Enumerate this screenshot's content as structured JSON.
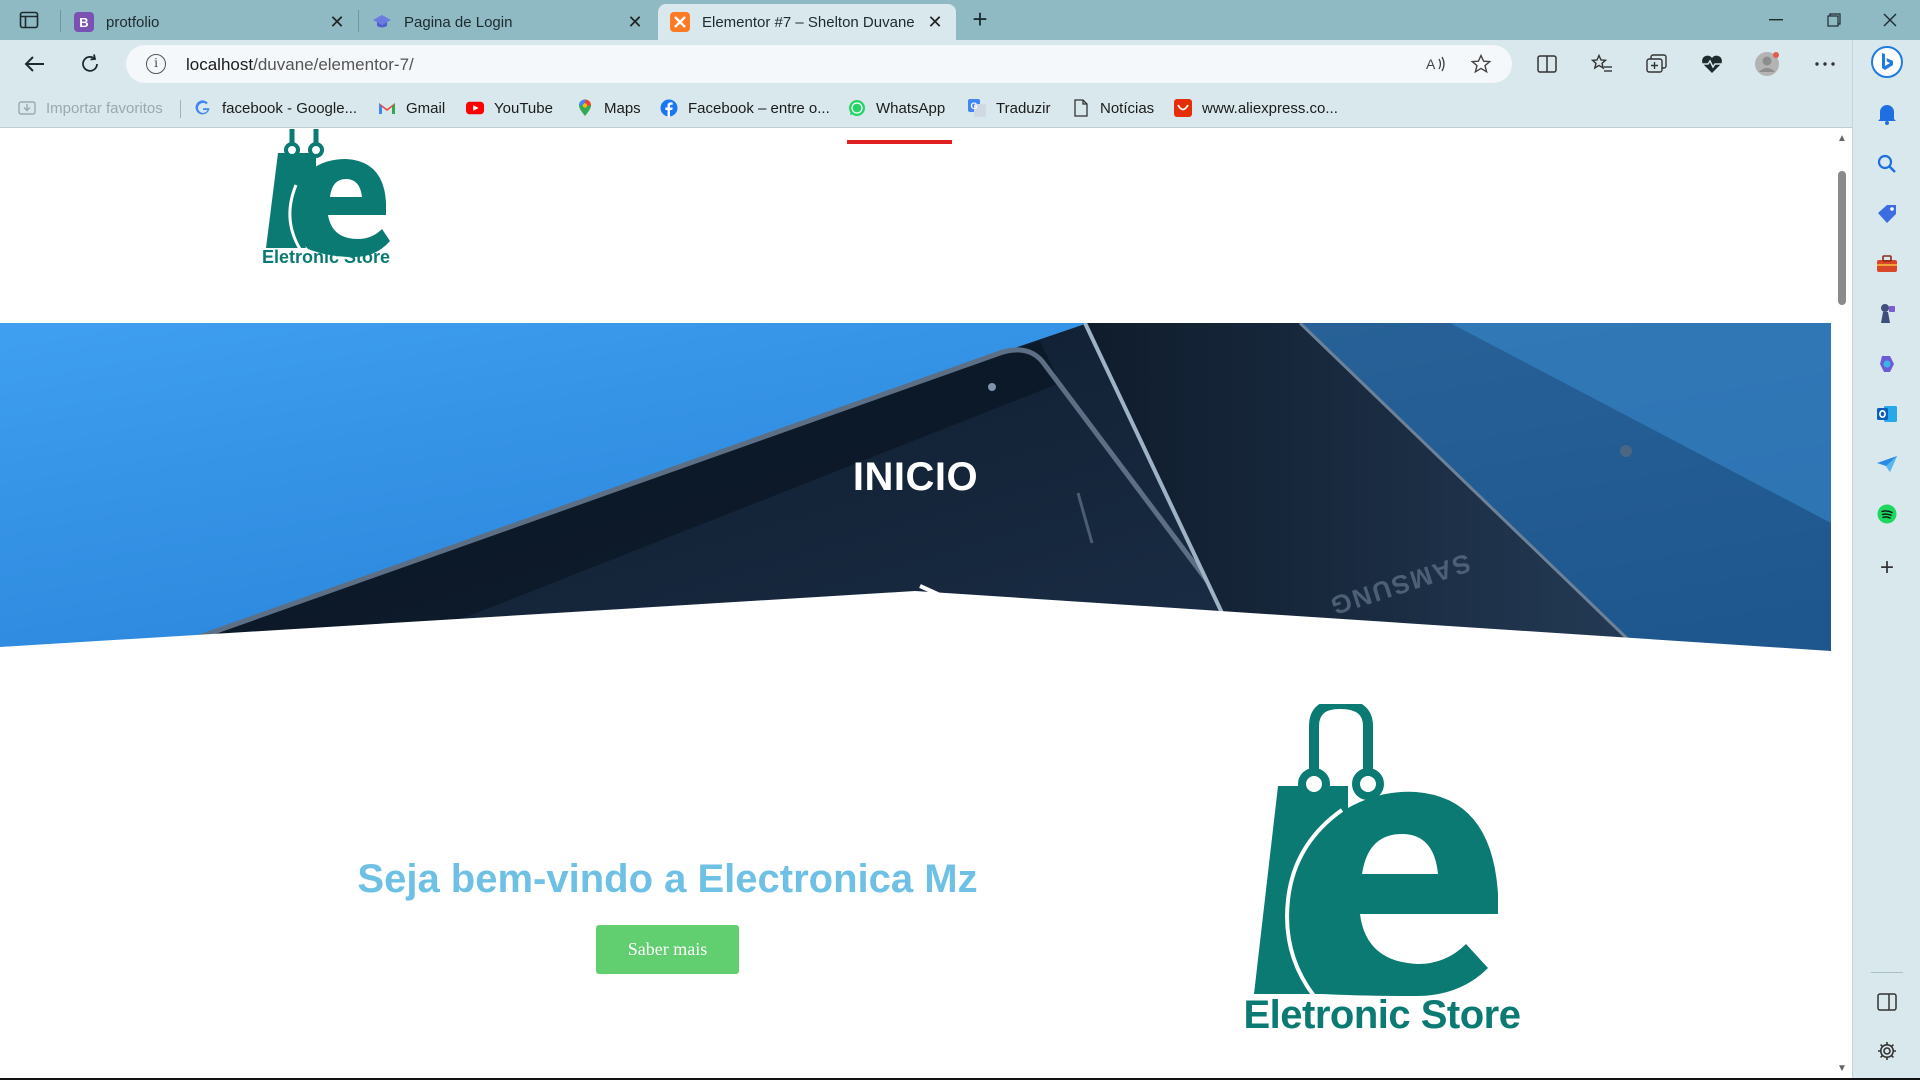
{
  "browser": {
    "tabs": [
      {
        "title": "protfolio",
        "favicon": "bootstrap-icon",
        "favicon_letter": "B",
        "favicon_color": "#7952b3",
        "active": false
      },
      {
        "title": "Pagina de Login",
        "favicon": "graduation-cap-icon",
        "favicon_color": "#6b7be0",
        "active": false
      },
      {
        "title": "Elementor #7 – Shelton Duvane",
        "favicon": "xampp-icon",
        "favicon_color": "#fb7a24",
        "active": true
      }
    ],
    "tab_close_glyph": "✕",
    "new_tab_glyph": "+",
    "url_host": "localhost",
    "url_path": "/duvane/elementor-7/",
    "favorites": [
      {
        "label": "Importar favoritos",
        "icon": "import-favorites-icon",
        "disabled": true
      },
      {
        "label": "facebook - Google...",
        "icon": "google-icon"
      },
      {
        "label": "Gmail",
        "icon": "gmail-icon"
      },
      {
        "label": "YouTube",
        "icon": "youtube-icon"
      },
      {
        "label": "Maps",
        "icon": "maps-pin-icon"
      },
      {
        "label": "Facebook – entre o...",
        "icon": "facebook-icon"
      },
      {
        "label": "WhatsApp",
        "icon": "whatsapp-icon"
      },
      {
        "label": "Traduzir",
        "icon": "translate-icon"
      },
      {
        "label": "Notícias",
        "icon": "document-icon"
      },
      {
        "label": "www.aliexpress.co...",
        "icon": "aliexpress-icon"
      }
    ]
  },
  "page": {
    "hero_title": "INICIO",
    "welcome_title": "Seja bem-vindo a Electronica Mz",
    "cta_label": "Saber mais",
    "logo_text": "Eletronic Store",
    "hero_phone_brand": "SAMSUNG"
  },
  "colors": {
    "brand_teal": "#0a7a73",
    "welcome_blue": "#6ec1e4",
    "cta_green": "#61ce70",
    "nav_active_red": "#e02020",
    "hero_blue": "#2f8fe0"
  }
}
